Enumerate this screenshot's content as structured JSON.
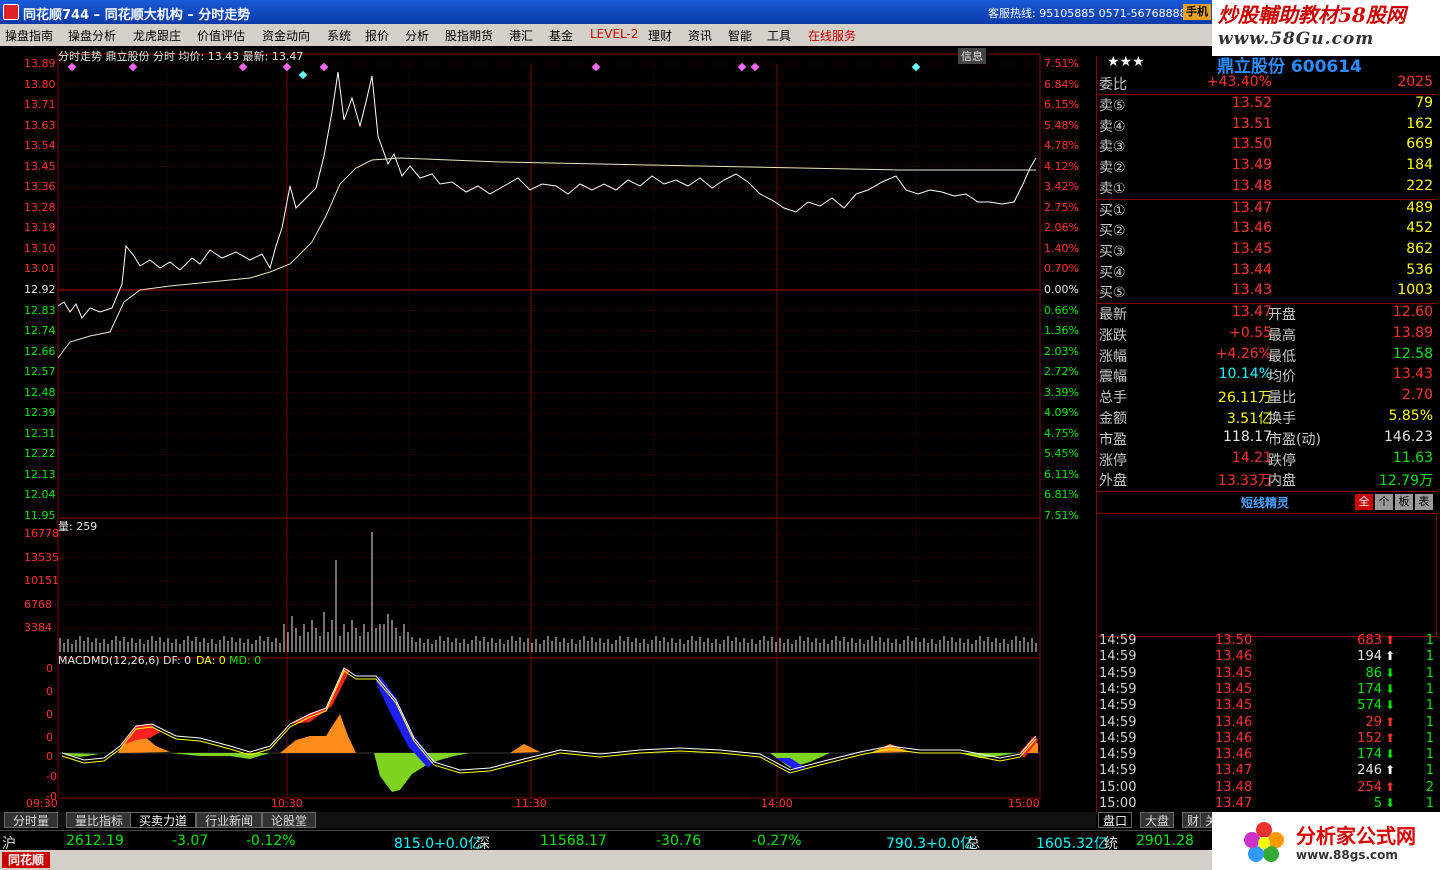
{
  "titlebar": {
    "title": "同花顺744 – 同花顺大机构 – 分时走势",
    "hotline": "客服热线: 95105885  0571-56768888",
    "hand_button": "手机",
    "brand_line1": "炒股輔助教材58股网",
    "brand_line2": "www.58Gu.com"
  },
  "menu": [
    "操盘指南",
    "操盘分析",
    "龙虎跟庄",
    "价值评估",
    "资金动向",
    "系统",
    "报价",
    "分析",
    "股指期货",
    "港汇",
    "基金",
    "LEVEL-2",
    "理财",
    "资讯",
    "智能",
    "工具",
    "在线服务"
  ],
  "chart": {
    "header": "分时走势  鼎立股份  分时  均价: 13.43  最新: 13.47",
    "btn_info": "信息",
    "price_ticks": [
      "13.89",
      "13.80",
      "13.71",
      "13.63",
      "13.54",
      "13.45",
      "13.36",
      "13.28",
      "13.19",
      "13.10",
      "13.01",
      "12.92",
      "12.83",
      "12.74",
      "12.66",
      "12.57",
      "12.48",
      "12.39",
      "12.31",
      "12.22",
      "12.13",
      "12.04",
      "11.95"
    ],
    "pct_ticks": [
      "7.51%",
      "6.84%",
      "6.15%",
      "5.48%",
      "4.78%",
      "4.12%",
      "3.42%",
      "2.75%",
      "2.06%",
      "1.40%",
      "0.70%",
      "0.00%",
      "0.66%",
      "1.36%",
      "2.03%",
      "2.72%",
      "3.39%",
      "4.09%",
      "4.75%",
      "5.45%",
      "6.11%",
      "6.81%",
      "7.51%"
    ],
    "volume_label": "量: 259",
    "volume_ticks": [
      "16778",
      "13535",
      "10151",
      "6768",
      "3384"
    ],
    "macd_label_main": "MACDMD(12,26,6) DF: 0",
    "macd_label_da": "DA: 0",
    "macd_label_md": "MD: 0",
    "macd_ticks": [
      "0",
      "0",
      "0",
      "0",
      "0",
      "-0",
      "-0"
    ],
    "time_ticks": [
      "09:30",
      "10:30",
      "11:30",
      "14:00",
      "15:00"
    ],
    "colors": {
      "price_line": "#ffffff",
      "avg_line": "#ffff00",
      "grid": "#800000",
      "up": "#ff3232",
      "down": "#00e600"
    }
  },
  "panel": {
    "stars": "★★★",
    "stock_name": "鼎立股份 600614",
    "ratio": {
      "label": "委比",
      "pct": "+43.40%",
      "diff": "2025"
    },
    "sells": [
      {
        "label": "卖⑤",
        "price": "13.52",
        "vol": "79"
      },
      {
        "label": "卖④",
        "price": "13.51",
        "vol": "162"
      },
      {
        "label": "卖③",
        "price": "13.50",
        "vol": "669"
      },
      {
        "label": "卖②",
        "price": "13.49",
        "vol": "184"
      },
      {
        "label": "卖①",
        "price": "13.48",
        "vol": "222"
      }
    ],
    "buys": [
      {
        "label": "买①",
        "price": "13.47",
        "vol": "489"
      },
      {
        "label": "买②",
        "price": "13.46",
        "vol": "452"
      },
      {
        "label": "买③",
        "price": "13.45",
        "vol": "862"
      },
      {
        "label": "买④",
        "price": "13.44",
        "vol": "536"
      },
      {
        "label": "买⑤",
        "price": "13.43",
        "vol": "1003"
      }
    ],
    "stats": [
      {
        "l1": "最新",
        "v1": "13.47",
        "l2": "开盘",
        "v2": "12.60"
      },
      {
        "l1": "涨跌",
        "v1": "+0.55",
        "l2": "最高",
        "v2": "13.89"
      },
      {
        "l1": "涨幅",
        "v1": "+4.26%",
        "l2": "最低",
        "v2": "12.58"
      },
      {
        "l1": "震幅",
        "v1": "10.14%",
        "l2": "均价",
        "v2": "13.43"
      },
      {
        "l1": "总手",
        "v1": "26.11万",
        "l2": "量比",
        "v2": "2.70"
      },
      {
        "l1": "金额",
        "v1": "3.51亿",
        "l2": "换手",
        "v2": "5.85%"
      },
      {
        "l1": "市盈",
        "v1": "118.17",
        "l2": "市盈(动)",
        "v2": "146.23"
      },
      {
        "l1": "涨停",
        "v1": "14.21",
        "l2": "跌停",
        "v2": "11.63"
      },
      {
        "l1": "外盘",
        "v1": "13.33万",
        "l2": "内盘",
        "v2": "12.79万"
      }
    ],
    "elf_title": "短线精灵",
    "elf_tabs": [
      "全",
      "个",
      "板",
      "表"
    ],
    "ticks": [
      {
        "t": "14:59",
        "p": "13.50",
        "v": "683",
        "d": "up",
        "n": "1"
      },
      {
        "t": "14:59",
        "p": "13.46",
        "v": "194",
        "d": "upw",
        "n": "1"
      },
      {
        "t": "14:59",
        "p": "13.45",
        "v": "86",
        "d": "down",
        "n": "1"
      },
      {
        "t": "14:59",
        "p": "13.45",
        "v": "174",
        "d": "down",
        "n": "1"
      },
      {
        "t": "14:59",
        "p": "13.45",
        "v": "574",
        "d": "down",
        "n": "1"
      },
      {
        "t": "14:59",
        "p": "13.46",
        "v": "29",
        "d": "up",
        "n": "1"
      },
      {
        "t": "14:59",
        "p": "13.46",
        "v": "152",
        "d": "up",
        "n": "1"
      },
      {
        "t": "14:59",
        "p": "13.46",
        "v": "174",
        "d": "down",
        "n": "1"
      },
      {
        "t": "14:59",
        "p": "13.47",
        "v": "246",
        "d": "upw",
        "n": "1"
      },
      {
        "t": "15:00",
        "p": "13.48",
        "v": "254",
        "d": "up",
        "n": "2"
      },
      {
        "t": "15:00",
        "p": "13.47",
        "v": "5",
        "d": "down",
        "n": "1"
      }
    ]
  },
  "tabs": [
    "分时量",
    "量比指标",
    "买卖力道",
    "行业新闻",
    "论股堂"
  ],
  "rtabs": [
    "盘口",
    "大盘",
    "财",
    "关"
  ],
  "ticker": {
    "sh_label": "沪",
    "sh_val": "2612.19",
    "sh_chg": "-3.07",
    "sh_pct": "-0.12%",
    "sh_amt": "815.0+0.0亿",
    "sz_label": "深",
    "sz_val": "11568.17",
    "sz_chg": "-30.76",
    "sz_pct": "-0.27%",
    "sz_amt": "790.3+0.0亿",
    "tot_label": "总",
    "tot_val": "1605.32亿",
    "tong_label": "统",
    "tong_val": "2901.28"
  },
  "statusbar": {
    "logo": "同花顺"
  },
  "logo2": {
    "name": "分析家公式网",
    "url": "www.88gs.com"
  }
}
